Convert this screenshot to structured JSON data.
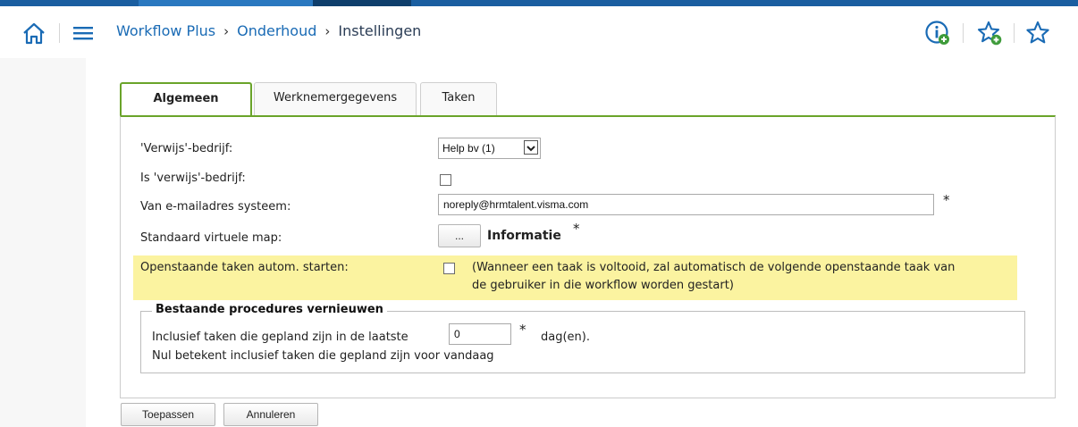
{
  "breadcrumb": {
    "item1": "Workflow Plus",
    "item2": "Onderhoud",
    "item3": "Instellingen",
    "separator": "›"
  },
  "tabs": [
    {
      "label": "Algemeen",
      "active": true
    },
    {
      "label": "Werknemergegevens",
      "active": false
    },
    {
      "label": "Taken",
      "active": false
    }
  ],
  "form": {
    "verwijs_bedrijf": {
      "label": "'Verwijs'-bedrijf:",
      "value": "Help bv (1)"
    },
    "is_verwijs_bedrijf": {
      "label": "Is 'verwijs'-bedrijf:",
      "checked": false
    },
    "van_emailadres": {
      "label": "Van e-mailadres systeem:",
      "value": "noreply@hrmtalent.visma.com",
      "required_mark": "*"
    },
    "virtuele_map": {
      "label": "Standaard virtuele map:",
      "button_label": "...",
      "value": "Informatie",
      "required_mark": "*"
    },
    "openstaande_taken": {
      "label": "Openstaande taken autom. starten:",
      "checked": false,
      "description_line1": "(Wanneer een taak is voltooid, zal automatisch de volgende openstaande taak van",
      "description_line2": "de gebruiker in die workflow worden gestart)"
    }
  },
  "procedures": {
    "legend": "Bestaande procedures vernieuwen",
    "prefix": "Inclusief taken die gepland zijn in de laatste",
    "days_value": "0",
    "required_mark": "*",
    "suffix": "dag(en).",
    "note": "Nul betekent inclusief taken die gepland zijn voor vandaag"
  },
  "actions": {
    "apply_label": "Toepassen",
    "cancel_label": "Annuleren"
  },
  "icons": [
    "home-icon",
    "menu-icon",
    "info-add-icon",
    "favorite-add-icon",
    "favorite-icon"
  ],
  "colors": {
    "accent_blue": "#1a6bb5",
    "tab_green": "#6aa42a",
    "highlight_yellow": "#fbf3a0",
    "topbar_blue": "#1a5ea0"
  }
}
